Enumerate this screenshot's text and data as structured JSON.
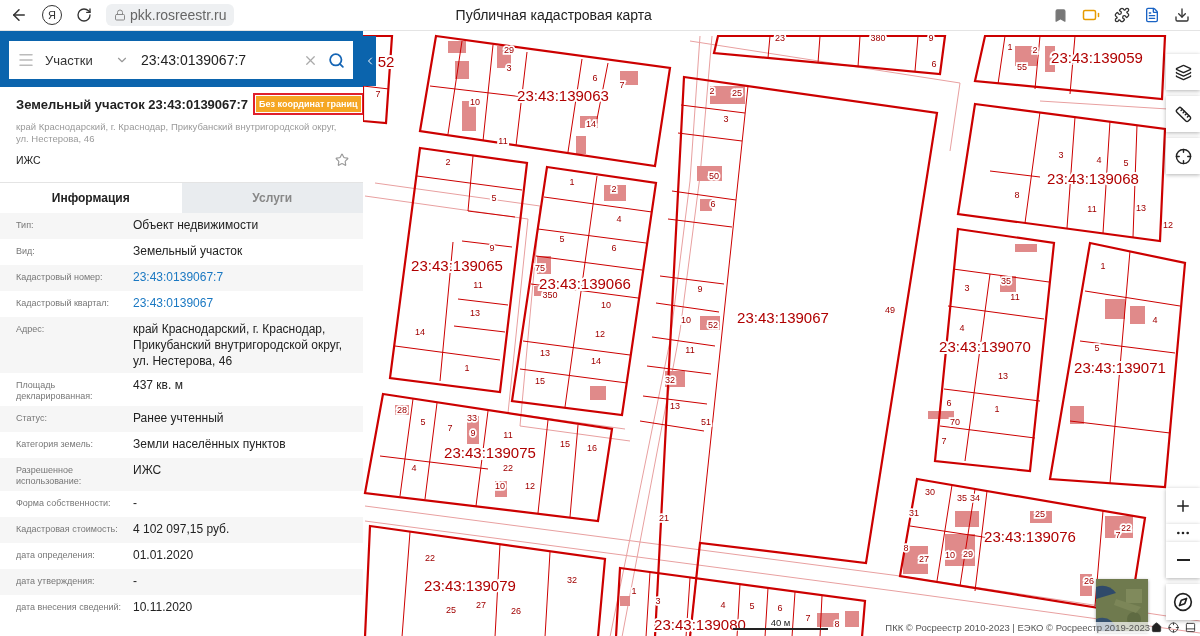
{
  "browser": {
    "logo": "Я",
    "url": "pkk.rosreestr.ru",
    "title": "Публичная кадастровая карта"
  },
  "search": {
    "category": "Участки",
    "value": "23:43:0139067:7"
  },
  "object": {
    "title": "Земельный участок 23:43:0139067:7",
    "badge": "Без координат границ",
    "address": "край Краснодарский, г. Краснодар, Прикубанский внутригородской округ, ул. Нестерова, 46",
    "purpose": "ИЖС",
    "favorite": false
  },
  "tabs": [
    {
      "label": "Информация",
      "selected": true
    },
    {
      "label": "Услуги",
      "selected": false
    }
  ],
  "fields": [
    {
      "label": "Тип:",
      "value": "Объект недвижимости",
      "kind": "text"
    },
    {
      "label": "Вид:",
      "value": "Земельный участок",
      "kind": "text"
    },
    {
      "label": "Кадастровый номер:",
      "value": "23:43:0139067:7",
      "kind": "link"
    },
    {
      "label": "Кадастровый квартал:",
      "value": "23:43:0139067",
      "kind": "link"
    },
    {
      "label": "Адрес:",
      "value": "край Краснодарский, г. Краснодар, Прикубанский внутригородской округ, ул. Нестерова, 46",
      "kind": "text"
    },
    {
      "label": "Площадь декларированная:",
      "value": "437 кв. м",
      "kind": "text"
    },
    {
      "label": "Статус:",
      "value": "Ранее учтенный",
      "kind": "text"
    },
    {
      "label": "Категория земель:",
      "value": "Земли населённых пунктов",
      "kind": "text"
    },
    {
      "label": "Разрешенное использование:",
      "value": "ИЖС",
      "kind": "text"
    },
    {
      "label": "Форма собственности:",
      "value": "-",
      "kind": "text"
    },
    {
      "label": "Кадастровая стоимость:",
      "value": "4 102 097,15 руб.",
      "kind": "text"
    },
    {
      "label": "дата определения:",
      "value": "01.01.2020",
      "kind": "text"
    },
    {
      "label": "дата утверждения:",
      "value": "-",
      "kind": "text"
    },
    {
      "label": "дата внесения сведений:",
      "value": "10.11.2020",
      "kind": "text"
    }
  ],
  "map": {
    "blocks": [
      {
        "label": "52",
        "parcels": [
          "7"
        ]
      },
      {
        "label": "23:43:139063",
        "parcels": [
          "29",
          "3",
          "6",
          "7",
          "10",
          "11",
          "14"
        ]
      },
      {
        "parcels": [
          "23",
          "380",
          "9",
          "6"
        ]
      },
      {
        "label": "23:43:139059",
        "parcels": [
          "1",
          "55",
          "2"
        ]
      },
      {
        "label": "23:43:139065",
        "parcels": [
          "2",
          "5",
          "9",
          "11",
          "13",
          "14",
          "1"
        ]
      },
      {
        "label": "23:43:139066",
        "parcels": [
          "1",
          "2",
          "4",
          "5",
          "6",
          "75",
          "350",
          "10",
          "12",
          "13",
          "14",
          "15"
        ]
      },
      {
        "label": "23:43:139067",
        "parcels": [
          "2",
          "25",
          "3",
          "50",
          "6",
          "9",
          "10",
          "52",
          "11",
          "32",
          "13",
          "51",
          "21",
          "49"
        ]
      },
      {
        "label": "23:43:139068",
        "parcels": [
          "3",
          "4",
          "5",
          "8",
          "11",
          "13",
          "12"
        ]
      },
      {
        "label": "23:43:139070",
        "parcels": [
          "35",
          "3",
          "11",
          "4",
          "13",
          "6",
          "70",
          "1",
          "7"
        ]
      },
      {
        "label": "23:43:139071",
        "parcels": [
          "1",
          "4",
          "5"
        ]
      },
      {
        "label": "23:43:139075",
        "parcels": [
          "28",
          "5",
          "7",
          "33",
          "9",
          "11",
          "15",
          "16",
          "4",
          "22",
          "10",
          "12"
        ]
      },
      {
        "label": "23:43:139076",
        "parcels": [
          "30",
          "35",
          "34",
          "31",
          "25",
          "22",
          "7",
          "8",
          "10",
          "29",
          "27",
          "26"
        ]
      },
      {
        "label": "23:43:139079",
        "parcels": [
          "22",
          "32",
          "25",
          "27",
          "26"
        ]
      },
      {
        "label": "23:43:139080",
        "parcels": [
          "1",
          "3",
          "4",
          "5",
          "6",
          "7",
          "8"
        ]
      }
    ],
    "scale": "40 м",
    "attribution": "ПКК © Росреестр 2010-2023 | ЕЭКО © Росреестр 2019-2023"
  }
}
